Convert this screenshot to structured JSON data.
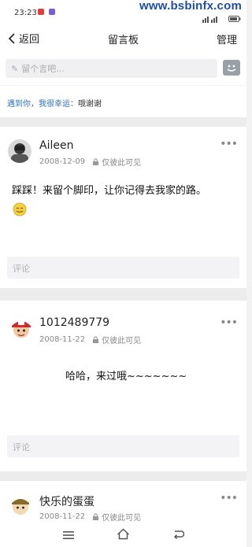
{
  "status": {
    "time": "23:23",
    "watermark": "www.bsbinfx.com"
  },
  "nav": {
    "back_label": "返回",
    "title": "留言板",
    "manage_label": "管理"
  },
  "input": {
    "placeholder": "留个言吧..."
  },
  "motto": {
    "prefix": "遇到你，我很幸运：",
    "text": "哦谢谢"
  },
  "posts": [
    {
      "user": "Aileen",
      "date": "2008-12-09",
      "visibility": "仅彼此可见",
      "content": "踩踩！来留个脚印，让你记得去我家的路。",
      "comment_placeholder": "评论"
    },
    {
      "user": "1012489779",
      "date": "2008-11-22",
      "visibility": "仅彼此可见",
      "content": "哈哈，来过哦~~~~~~~",
      "comment_placeholder": "评论"
    },
    {
      "user": "快乐的蛋蛋",
      "date": "2008-11-22",
      "visibility": "仅彼此可见"
    }
  ],
  "icons": {
    "back": "chevron-left-icon",
    "pencil": "pencil-icon",
    "emoji": "emoji-icon",
    "lock": "lock-icon",
    "more": "more-dots-icon",
    "smiley": "smiley-icon",
    "menu": "menu-icon",
    "home": "home-icon",
    "return": "return-icon"
  },
  "colors": {
    "link_blue": "#2c6fb7",
    "watermark_blue": "#1f4fa0"
  }
}
